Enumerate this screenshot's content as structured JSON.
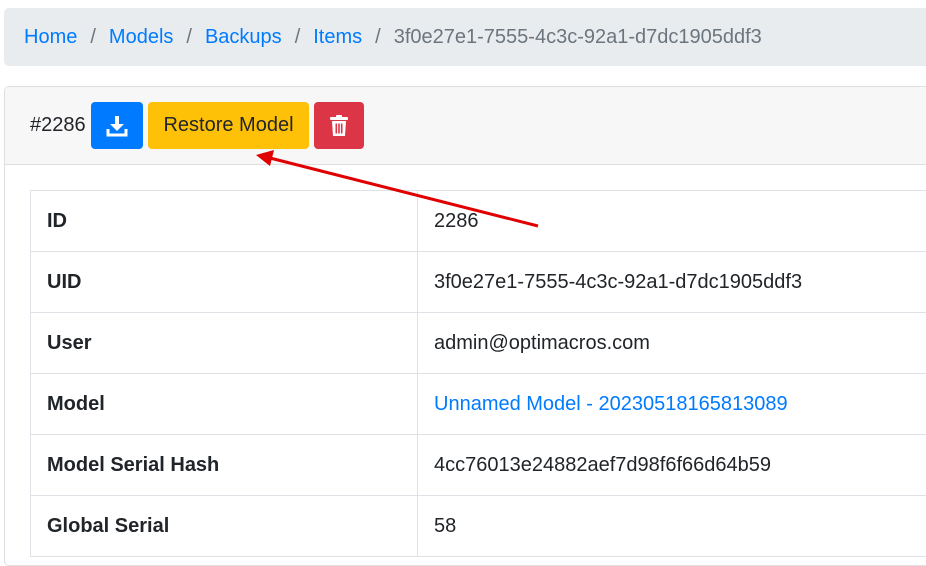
{
  "breadcrumb": {
    "items": [
      {
        "label": "Home"
      },
      {
        "label": "Models"
      },
      {
        "label": "Backups"
      },
      {
        "label": "Items"
      }
    ],
    "current": "3f0e27e1-7555-4c3c-92a1-d7dc1905ddf3",
    "separator": "/"
  },
  "header": {
    "record_id": "#2286",
    "download_icon": "download-icon",
    "restore_label": "Restore Model",
    "delete_icon": "trash-icon"
  },
  "details": {
    "rows": [
      {
        "key": "ID",
        "value": "2286"
      },
      {
        "key": "UID",
        "value": "3f0e27e1-7555-4c3c-92a1-d7dc1905ddf3"
      },
      {
        "key": "User",
        "value": "admin@optimacros.com"
      },
      {
        "key": "Model",
        "value": "Unnamed Model - 20230518165813089"
      },
      {
        "key": "Model Serial Hash",
        "value": "4cc76013e24882aef7d98f6f66d64b59"
      },
      {
        "key": "Global Serial",
        "value": "58"
      }
    ]
  },
  "colors": {
    "primary": "#007bff",
    "warning": "#ffc107",
    "danger": "#dc3545",
    "annotation_arrow": "#e00000"
  }
}
